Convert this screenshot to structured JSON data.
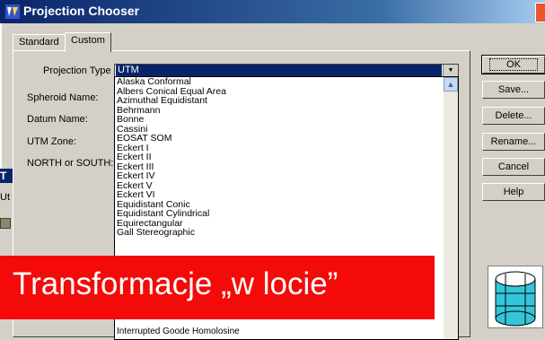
{
  "window": {
    "title": "Projection Chooser",
    "accent": "#0a246a"
  },
  "tabs": [
    {
      "label": "Standard",
      "active": false
    },
    {
      "label": "Custom",
      "active": true
    }
  ],
  "fields": {
    "projection_type_label": "Projection Type :",
    "spheroid_label": "Spheroid Name:",
    "datum_label": "Datum Name:",
    "utm_zone_label": "UTM Zone:",
    "north_south_label": "NORTH or SOUTH:",
    "projection_type_value": "UTM"
  },
  "dropdown": {
    "options": [
      "Alaska Conformal",
      "Albers Conical Equal Area",
      "Azimuthal Equidistant",
      "Behrmann",
      "Bonne",
      "Cassini",
      "EOSAT SOM",
      "Eckert I",
      "Eckert II",
      "Eckert III",
      "Eckert IV",
      "Eckert V",
      "Eckert VI",
      "Equidistant Conic",
      "Equidistant Cylindrical",
      "Equirectangular",
      "Gall Stereographic"
    ],
    "cut_off_bottom": "Interrupted Goode Homolosine"
  },
  "buttons": {
    "ok": "OK",
    "save": "Save...",
    "delete": "Delete...",
    "rename": "Rename...",
    "cancel": "Cancel",
    "help": "Help"
  },
  "background_window": {
    "title_fragment": "T",
    "text_fragment": "Ut"
  },
  "banner": {
    "text": "Transformacje „w locie”",
    "color": "#f50a0a"
  }
}
